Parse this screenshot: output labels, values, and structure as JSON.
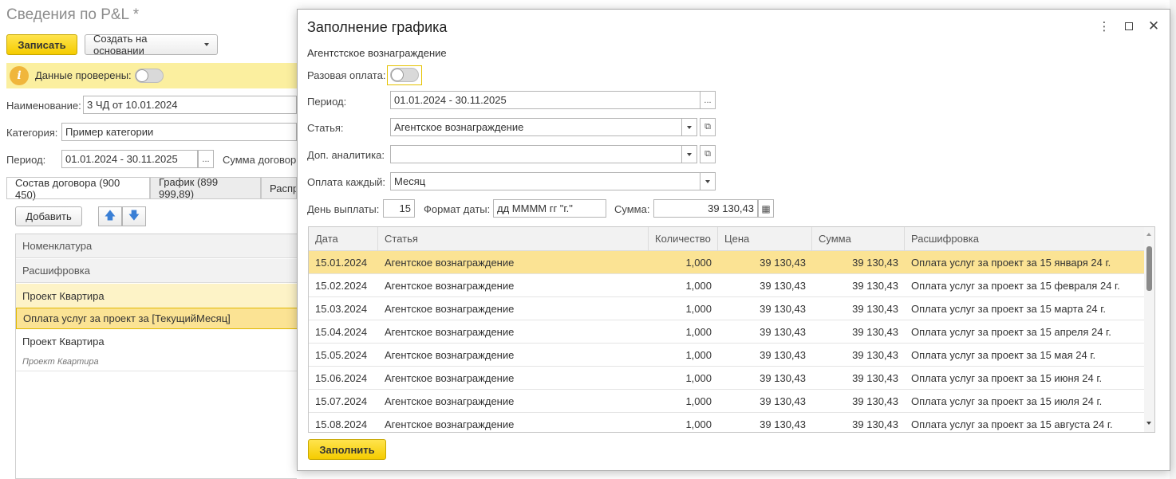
{
  "background_form": {
    "title": "Сведения по P&L *",
    "save_button": "Записать",
    "create_based_button": "Создать на основании",
    "info_bar_label": "Данные проверены:",
    "name_label": "Наименование:",
    "name_value": "3 ЧД от 10.01.2024",
    "category_label": "Категория:",
    "category_value": "Пример категории",
    "period_label": "Период:",
    "period_value": "01.01.2024 - 30.11.2025",
    "contract_sum_label": "Сумма договор",
    "tabs": [
      "Состав договора (900 450)",
      "График (899 999,89)",
      "Распр"
    ],
    "add_button": "Добавить",
    "table_header_1": "Номенклатура",
    "table_header_2": "Расшифровка",
    "rows": [
      {
        "text": "Проект Квартира"
      },
      {
        "text": "Оплата услуг за проект за [ТекущийМесяц]"
      },
      {
        "text": "Проект Квартира"
      },
      {
        "text": "Проект Квартира"
      }
    ]
  },
  "dialog": {
    "title": "Заполнение графика",
    "subtitle": "Агентстское вознаграждение",
    "one_time_label": "Разовая оплата:",
    "period_label": "Период:",
    "period_value": "01.01.2024 - 30.11.2025",
    "article_label": "Статья:",
    "article_value": "Агентское вознаграждение",
    "extra_label": "Доп. аналитика:",
    "extra_value": "",
    "pay_each_label": "Оплата каждый:",
    "pay_each_value": "Месяц",
    "payday_label": "День выплаты:",
    "payday_value": "15",
    "date_format_label": "Формат даты:",
    "date_format_value": "дд ММММ гг \"г.\"",
    "sum_label": "Сумма:",
    "sum_value": "39 130,43",
    "fill_button": "Заполнить",
    "grid": {
      "columns": [
        "Дата",
        "Статья",
        "Количество",
        "Цена",
        "Сумма",
        "Расшифровка"
      ],
      "rows": [
        {
          "date": "15.01.2024",
          "article": "Агентское вознаграждение",
          "qty": "1,000",
          "price": "39 130,43",
          "sum": "39 130,43",
          "desc": "Оплата услуг за проект за 15 января 24 г."
        },
        {
          "date": "15.02.2024",
          "article": "Агентское вознаграждение",
          "qty": "1,000",
          "price": "39 130,43",
          "sum": "39 130,43",
          "desc": "Оплата услуг за проект за 15 февраля 24 г."
        },
        {
          "date": "15.03.2024",
          "article": "Агентское вознаграждение",
          "qty": "1,000",
          "price": "39 130,43",
          "sum": "39 130,43",
          "desc": "Оплата услуг за проект за 15 марта 24 г."
        },
        {
          "date": "15.04.2024",
          "article": "Агентское вознаграждение",
          "qty": "1,000",
          "price": "39 130,43",
          "sum": "39 130,43",
          "desc": "Оплата услуг за проект за 15 апреля 24 г."
        },
        {
          "date": "15.05.2024",
          "article": "Агентское вознаграждение",
          "qty": "1,000",
          "price": "39 130,43",
          "sum": "39 130,43",
          "desc": "Оплата услуг за проект за 15 мая 24 г."
        },
        {
          "date": "15.06.2024",
          "article": "Агентское вознаграждение",
          "qty": "1,000",
          "price": "39 130,43",
          "sum": "39 130,43",
          "desc": "Оплата услуг за проект за 15 июня 24 г."
        },
        {
          "date": "15.07.2024",
          "article": "Агентское вознаграждение",
          "qty": "1,000",
          "price": "39 130,43",
          "sum": "39 130,43",
          "desc": "Оплата услуг за проект за 15 июля 24 г."
        },
        {
          "date": "15.08.2024",
          "article": "Агентское вознаграждение",
          "qty": "1,000",
          "price": "39 130,43",
          "sum": "39 130,43",
          "desc": "Оплата услуг за проект за 15 августа 24 г."
        }
      ]
    }
  },
  "icons": {
    "info": "info-icon",
    "arrow_up": "arrow-up-icon",
    "arrow_down": "arrow-down-icon",
    "more": "more-vertical-icon",
    "maximize": "maximize-icon",
    "close": "close-icon",
    "dropdown": "chevron-down-icon",
    "open": "open-form-icon",
    "calculator": "calculator-icon"
  },
  "colors": {
    "accent_yellow": "#f5cc00",
    "info_bar": "#fbef9f",
    "selected_row": "#fbe394"
  }
}
